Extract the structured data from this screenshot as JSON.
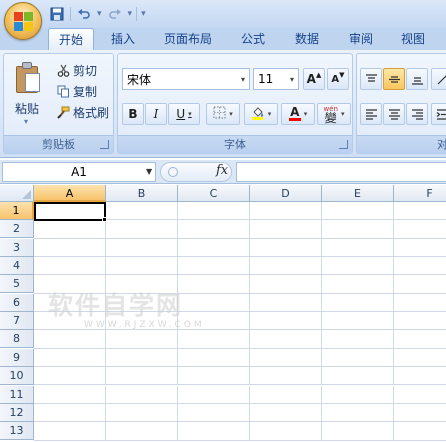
{
  "titlebar": {
    "qat_items": [
      "save-icon",
      "undo-icon",
      "redo-icon"
    ]
  },
  "tabs": [
    {
      "label": "开始",
      "active": true
    },
    {
      "label": "插入"
    },
    {
      "label": "页面布局"
    },
    {
      "label": "公式"
    },
    {
      "label": "数据"
    },
    {
      "label": "审阅"
    },
    {
      "label": "视图"
    }
  ],
  "clipboard": {
    "paste_label": "粘贴",
    "cut_label": "剪切",
    "copy_label": "复制",
    "format_painter_label": "格式刷",
    "group_label": "剪贴板"
  },
  "font": {
    "font_name": "宋体",
    "font_size": "11",
    "grow_label": "A",
    "shrink_label": "A",
    "bold_label": "B",
    "italic_label": "I",
    "underline_label": "U",
    "font_color_label": "A",
    "phonetic_label": "wén",
    "phonetic_char": "變",
    "group_label": "字体"
  },
  "alignment": {
    "group_label": "对"
  },
  "formula_bar": {
    "name_box": "A1",
    "fx_label": "fx",
    "formula": ""
  },
  "grid": {
    "columns": [
      "A",
      "B",
      "C",
      "D",
      "E",
      "F"
    ],
    "rows": [
      "1",
      "2",
      "3",
      "4",
      "5",
      "6",
      "7",
      "8",
      "9",
      "10",
      "11",
      "12",
      "13"
    ],
    "selected_cell": "A1"
  },
  "watermark": {
    "main": "软件自学网",
    "sub": "WWW.RJZXW.COM"
  },
  "colors": {
    "ribbon_text": "#15428b",
    "selection_header": "#f8c36b",
    "gridline": "#d0d7e5"
  }
}
